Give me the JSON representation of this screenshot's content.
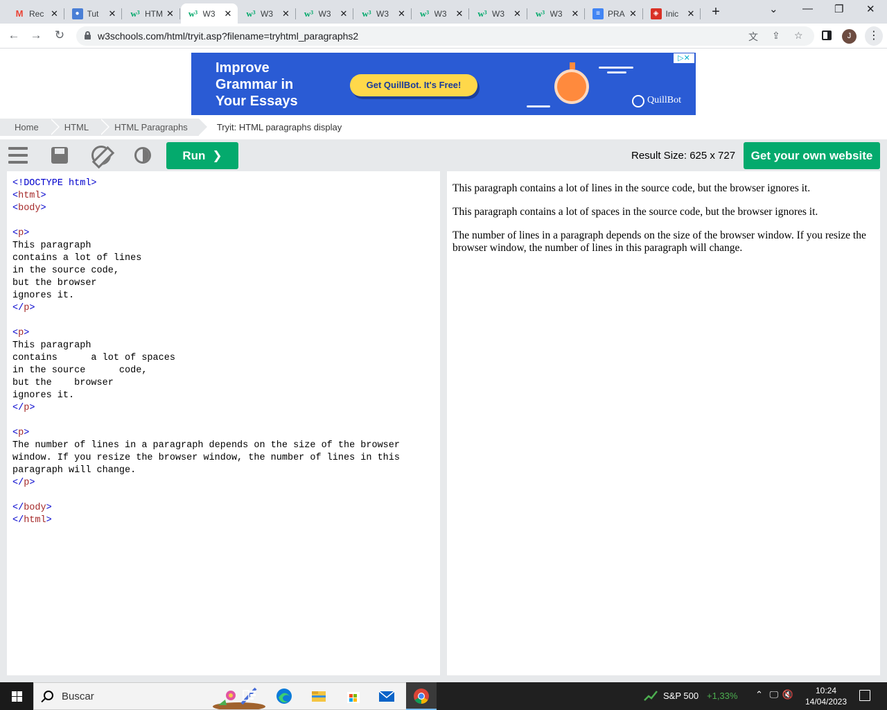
{
  "browser": {
    "tabs": [
      {
        "title": "Rec",
        "favicon": "gmail-icon",
        "active": false
      },
      {
        "title": "Tut",
        "favicon": "classroom-icon",
        "active": false
      },
      {
        "title": "HTM",
        "favicon": "w3schools-icon",
        "active": false
      },
      {
        "title": "W3",
        "favicon": "w3schools-icon",
        "active": true
      },
      {
        "title": "W3",
        "favicon": "w3schools-icon",
        "active": false
      },
      {
        "title": "W3",
        "favicon": "w3schools-icon",
        "active": false
      },
      {
        "title": "W3",
        "favicon": "w3schools-icon",
        "active": false
      },
      {
        "title": "W3",
        "favicon": "w3schools-icon",
        "active": false
      },
      {
        "title": "W3",
        "favicon": "w3schools-icon",
        "active": false
      },
      {
        "title": "W3",
        "favicon": "w3schools-icon",
        "active": false
      },
      {
        "title": "PRA",
        "favicon": "docs-icon",
        "active": false
      },
      {
        "title": "Inic",
        "favicon": "red-icon",
        "active": false
      }
    ],
    "url": "w3schools.com/html/tryit.asp?filename=tryhtml_paragraphs2",
    "profile_initial": "J"
  },
  "ad": {
    "headline": "Improve\nGrammar in\nYour Essays",
    "cta": "Get QuillBot. It's Free!",
    "brand": "QuillBot",
    "accent": "#2a5bd4"
  },
  "breadcrumb": [
    "Home",
    "HTML",
    "HTML Paragraphs",
    "Tryit: HTML paragraphs display"
  ],
  "toolbar": {
    "run_label": "Run",
    "result_size": "Result Size: 625 x 727",
    "get_website_label": "Get your own website",
    "accent": "#04aa6d"
  },
  "editor": {
    "lines": [
      "<!DOCTYPE html>",
      "<html>",
      "<body>",
      "",
      "<p>",
      "This paragraph",
      "contains a lot of lines",
      "in the source code,",
      "but the browser",
      "ignores it.",
      "</p>",
      "",
      "<p>",
      "This paragraph",
      "contains      a lot of spaces",
      "in the source      code,",
      "but the    browser",
      "ignores it.",
      "</p>",
      "",
      "<p>",
      "The number of lines in a paragraph depends on the size of the browser",
      "window. If you resize the browser window, the number of lines in this",
      "paragraph will change.",
      "</p>",
      "",
      "</body>",
      "</html>"
    ]
  },
  "result": {
    "paragraphs": [
      "This paragraph contains a lot of lines in the source code, but the browser ignores it.",
      "This paragraph contains a lot of spaces in the source code, but the browser ignores it.",
      "The number of lines in a paragraph depends on the size of the browser window. If you resize the browser window, the number of lines in this paragraph will change."
    ]
  },
  "taskbar": {
    "search_placeholder": "Buscar",
    "stock_name": "S&P 500",
    "stock_change": "+1,33%",
    "time": "10:24",
    "date": "14/04/2023"
  }
}
